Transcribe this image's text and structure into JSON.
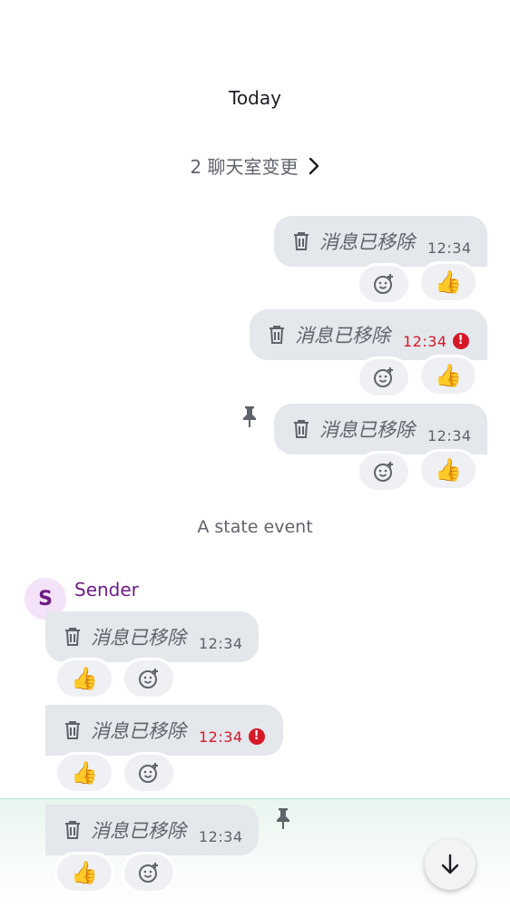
{
  "timeline": {
    "date_separator": "Today",
    "room_changes": "2 聊天室变更",
    "state_event": "A state event",
    "sender_name": "Sender",
    "sender_initial": "S"
  },
  "messages": [
    {
      "text": "消息已移除",
      "time": "12:34",
      "error": false,
      "pinned": false,
      "reaction": "👍"
    },
    {
      "text": "消息已移除",
      "time": "12:34",
      "error": true,
      "pinned": false,
      "reaction": "👍"
    },
    {
      "text": "消息已移除",
      "time": "12:34",
      "error": false,
      "pinned": true,
      "reaction": "👍"
    },
    {
      "text": "消息已移除",
      "time": "12:34",
      "error": false,
      "pinned": false,
      "reaction": "👍"
    },
    {
      "text": "消息已移除",
      "time": "12:34",
      "error": true,
      "pinned": false,
      "reaction": "👍"
    },
    {
      "text": "消息已移除",
      "time": "12:34",
      "error": false,
      "pinned": true,
      "reaction": "👍"
    }
  ],
  "icons": {
    "error": "!",
    "trash": "trash-icon",
    "add_reaction": "add-reaction-icon",
    "pin": "pin-icon",
    "chevron": "chevron-right-icon",
    "scroll_down": "arrow-down-icon"
  },
  "colors": {
    "bubble": "#e4e7ec",
    "error": "#d51928",
    "sender": "#6e1d87",
    "avatar_bg": "#f4e3f8",
    "composer": "#e8f5ee"
  }
}
